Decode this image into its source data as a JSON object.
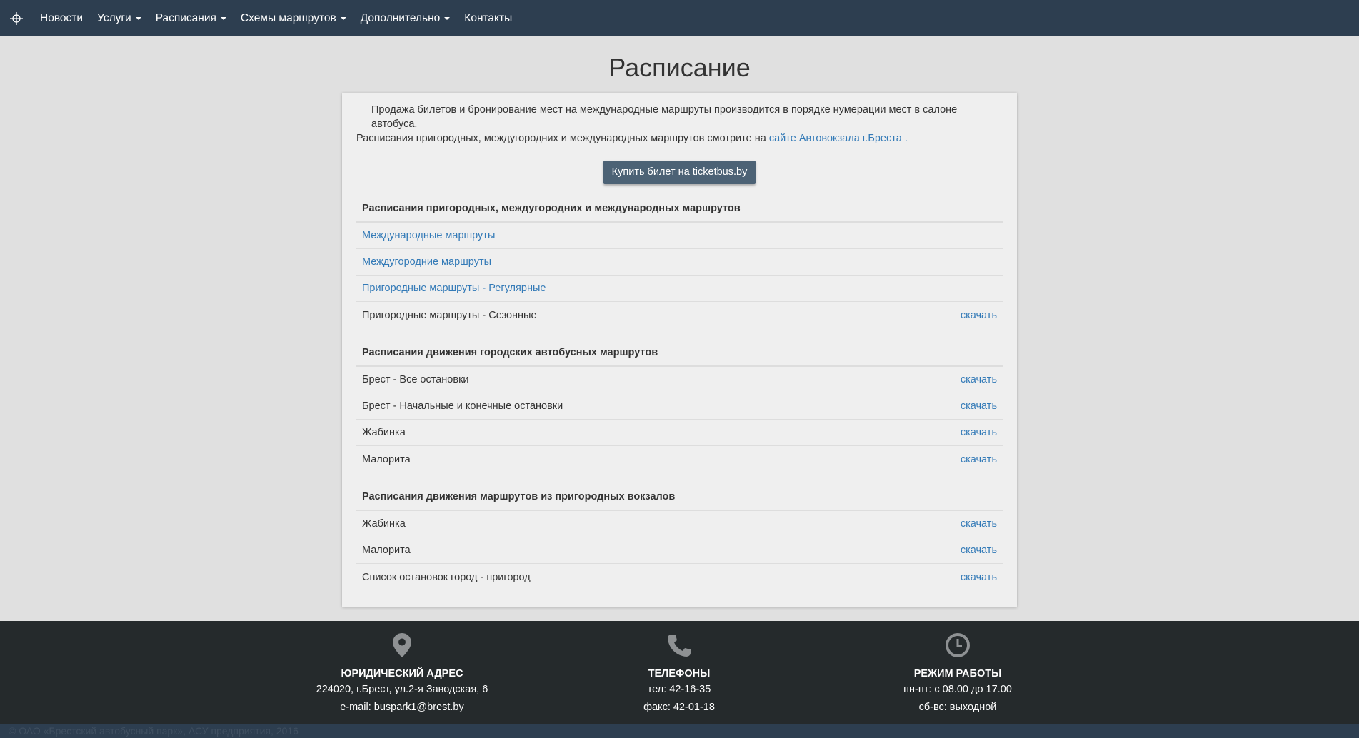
{
  "nav": {
    "brand_icon": "compass-icon",
    "items": [
      {
        "label": "Новости",
        "dropdown": false
      },
      {
        "label": "Услуги",
        "dropdown": true
      },
      {
        "label": "Расписания",
        "dropdown": true
      },
      {
        "label": "Схемы маршрутов",
        "dropdown": true
      },
      {
        "label": "Дополнительно",
        "dropdown": true
      },
      {
        "label": "Контакты",
        "dropdown": false
      }
    ]
  },
  "page": {
    "title": "Расписание"
  },
  "intro": {
    "line1": "Продажа билетов и бронирование мест на международные маршруты производится в порядке нумерации мест в салоне автобуса.",
    "line2_prefix": "Расписания пригородных, междугородних и международных маршрутов смотрите на ",
    "line2_link": "сайте Автовокзала г.Бреста",
    "line2_suffix": " ."
  },
  "buy_button": "Купить билет на ticketbus.by",
  "download_label": "скачать",
  "sections": [
    {
      "title": "Расписания пригородных, междугородних и международных маршрутов",
      "rows": [
        {
          "name": "Международные маршруты",
          "link": true,
          "download": false
        },
        {
          "name": "Междугородние маршруты",
          "link": true,
          "download": false
        },
        {
          "name": "Пригородные маршруты - Регулярные",
          "link": true,
          "download": false
        },
        {
          "name": "Пригородные маршруты - Сезонные",
          "link": false,
          "download": true
        }
      ]
    },
    {
      "title": "Расписания движения городских автобусных маршрутов",
      "rows": [
        {
          "name": "Брест - Все остановки",
          "link": false,
          "download": true
        },
        {
          "name": "Брест - Начальные и конечные остановки",
          "link": false,
          "download": true
        },
        {
          "name": "Жабинка",
          "link": false,
          "download": true
        },
        {
          "name": "Малорита",
          "link": false,
          "download": true
        }
      ]
    },
    {
      "title": "Расписания движения маршрутов из пригородных вокзалов",
      "rows": [
        {
          "name": "Жабинка",
          "link": false,
          "download": true
        },
        {
          "name": "Малорита",
          "link": false,
          "download": true
        },
        {
          "name": "Список остановок город - пригород",
          "link": false,
          "download": true
        }
      ]
    }
  ],
  "footer": {
    "address": {
      "icon": "map-marker-icon",
      "heading": "ЮРИДИЧЕСКИЙ АДРЕС",
      "line1": "224020, г.Брест, ул.2-я Заводская, 6",
      "line2": "e-mail: buspark1@brest.by"
    },
    "phones": {
      "icon": "phone-icon",
      "heading": "ТЕЛЕФОНЫ",
      "line1": "тел: 42-16-35",
      "line2": "факс: 42-01-18"
    },
    "hours": {
      "icon": "clock-icon",
      "heading": "РЕЖИМ РАБОТЫ",
      "line1": "пн-пт: с 08.00 до 17.00",
      "line2": "сб-вс: выходной"
    }
  },
  "copyright": "© ОАО «Брестский автобусный парк», АСУ предприятия, 2016",
  "colors": {
    "navbar": "#2d3e50",
    "link": "#337ab7",
    "button": "#4c6275",
    "footer": "#252a2c"
  }
}
